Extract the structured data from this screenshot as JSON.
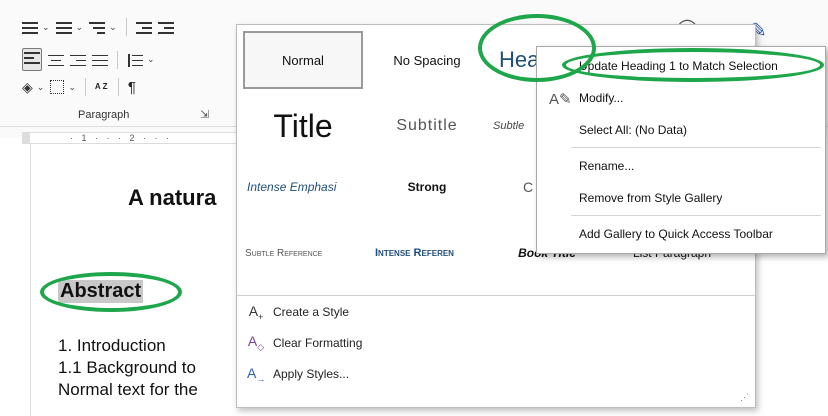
{
  "ribbon": {
    "group_label": "Paragraph",
    "sort_label": "A Z",
    "pilcrow": "¶"
  },
  "ruler": {
    "marks": "· 1 · · · 2 · · ·"
  },
  "document": {
    "title": "A natura",
    "abstract": "Abstract",
    "lines": [
      "1. Introduction",
      "1.1 Background to",
      "Normal text for the"
    ]
  },
  "gallery": {
    "styles": [
      {
        "name": "Normal",
        "style": "normal"
      },
      {
        "name": "No Spacing",
        "style": "nospacing"
      },
      {
        "name": "Hea",
        "style": "heading1"
      },
      {
        "name": "Title",
        "style": "title"
      },
      {
        "name": "Subtitle",
        "style": "subtitle"
      },
      {
        "name": "Subtle",
        "style": "subtle"
      },
      {
        "name": "Intense Emphasi",
        "style": "intense"
      },
      {
        "name": "Strong",
        "style": "strong"
      },
      {
        "name": "C",
        "style": "c"
      },
      {
        "name": "Subtle Reference",
        "style": "subtleref"
      },
      {
        "name": "Intense Referen",
        "style": "intenseref"
      },
      {
        "name": "Book Title",
        "style": "booktitle"
      },
      {
        "name": "List Paragraph",
        "style": "listpara"
      }
    ],
    "commands": [
      {
        "label": "Create a Style",
        "icon": "create-style-icon",
        "symbol": "A₊"
      },
      {
        "label": "Clear Formatting",
        "icon": "clear-formatting-icon",
        "symbol": "A◈"
      },
      {
        "label": "Apply Styles...",
        "icon": "apply-styles-icon",
        "symbol": "A→"
      }
    ]
  },
  "context_menu": {
    "items": [
      {
        "label": "Update Heading 1 to Match Selection"
      },
      {
        "label": "Modify...",
        "icon": "modify-icon"
      },
      {
        "label": "Select All: (No Data)"
      },
      {
        "label": "Rename..."
      },
      {
        "label": "Remove from Style Gallery"
      },
      {
        "label": "Add Gallery to Quick Access Toolbar"
      }
    ]
  },
  "colors": {
    "annotation_green": "#1ea64a",
    "heading1_blue": "#1f4e79"
  }
}
